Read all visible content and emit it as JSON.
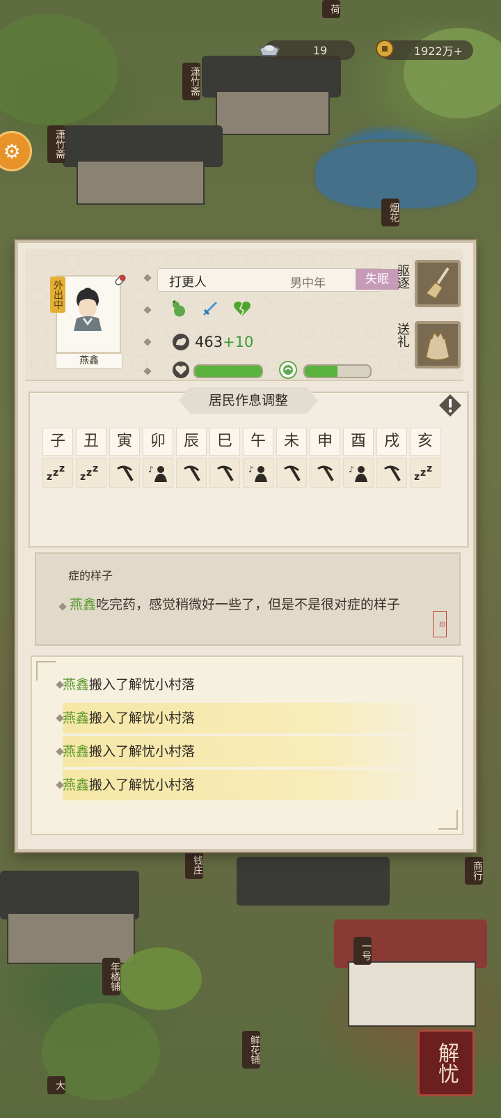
{
  "currency": {
    "silver": "19",
    "coins": "1922万+"
  },
  "scene_signs": [
    "荷",
    "潇竹斋",
    "潇竹斋",
    "烟花",
    "钱庄",
    "商行",
    "年橘铺",
    "鲜花铺",
    "一号",
    "大"
  ],
  "side_button_icon": "shop-icon",
  "corner_button": "解忧",
  "resident": {
    "name": "燕鑫",
    "status_tag": "外出中",
    "job": "打更人",
    "gender_age": "男中年",
    "condition": "失眠",
    "traits": [
      "gourd-icon",
      "sword-icon",
      "broken-heart-icon"
    ],
    "stat_value": "463",
    "stat_bonus": "+10",
    "health_fraction": 1.0,
    "mood_fraction": 0.5
  },
  "actions": {
    "expel": "驱逐",
    "gift": "送礼"
  },
  "schedule": {
    "title": "居民作息调整",
    "hours": [
      "子",
      "丑",
      "寅",
      "卯",
      "辰",
      "巳",
      "午",
      "未",
      "申",
      "酉",
      "戌",
      "亥"
    ],
    "activities": [
      "sleep",
      "sleep",
      "work",
      "leisure",
      "work",
      "work",
      "leisure",
      "work",
      "work",
      "leisure",
      "work",
      "sleep"
    ]
  },
  "message": {
    "faded_line": "症的样子",
    "name": "燕鑫",
    "text": "吃完药，感觉稍微好一些了，但是不是很对症的样子"
  },
  "log": [
    {
      "name": "燕鑫",
      "text": "搬入了解忧小村落",
      "highlight": false
    },
    {
      "name": "燕鑫",
      "text": "搬入了解忧小村落",
      "highlight": true
    },
    {
      "name": "燕鑫",
      "text": "搬入了解忧小村落",
      "highlight": true
    },
    {
      "name": "燕鑫",
      "text": "搬入了解忧小村落",
      "highlight": true
    }
  ],
  "colors": {
    "accent_green": "#5c9a2e",
    "condition_tag": "#c79ab8",
    "out_tag": "#e3b035"
  }
}
